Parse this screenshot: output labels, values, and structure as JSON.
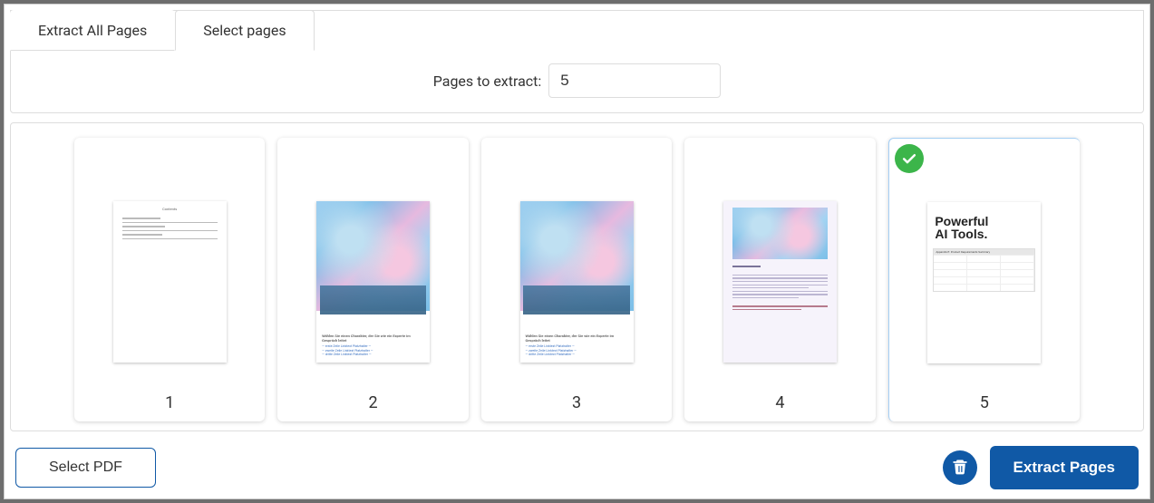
{
  "tabs": {
    "extract_all": "Extract All Pages",
    "select_pages": "Select pages",
    "active_index": 1
  },
  "pages_input": {
    "label": "Pages to extract:",
    "value": "5"
  },
  "thumbnails": [
    {
      "num": "1",
      "selected": false
    },
    {
      "num": "2",
      "selected": false
    },
    {
      "num": "3",
      "selected": false
    },
    {
      "num": "4",
      "selected": false
    },
    {
      "num": "5",
      "selected": true
    }
  ],
  "preview": {
    "five_heading_line1": "Powerful",
    "five_heading_line2": "AI Tools.",
    "five_table_header": "Appendix E:  Product Requirements Summary"
  },
  "buttons": {
    "select_pdf": "Select PDF",
    "extract_pages": "Extract Pages"
  },
  "colors": {
    "primary": "#1059a6",
    "success": "#3cb54a"
  }
}
